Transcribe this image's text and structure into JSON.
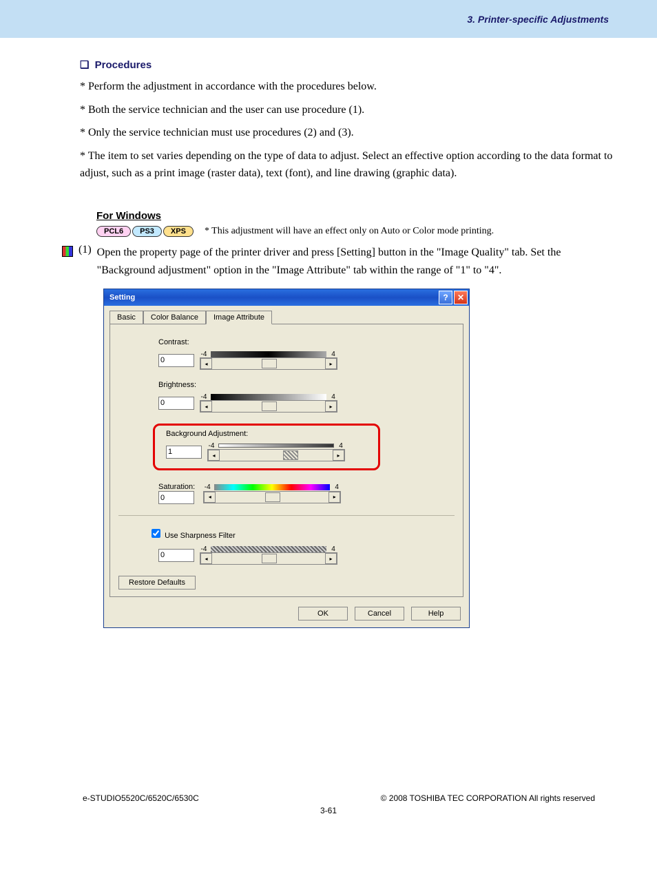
{
  "header": {
    "chapter": "3. Printer-specific Adjustments"
  },
  "procedures": {
    "heading": "Procedures",
    "lines": [
      "* Perform the adjustment in accordance with the procedures below.",
      "* Both the service technician and the user can use procedure (1).",
      "* Only the service technician must use procedures (2) and (3).",
      "* The item to set varies depending on the type of data to adjust.  Select an effective option according to the data format to adjust, such as a print image (raster data), text (font), and line drawing (graphic data)."
    ]
  },
  "for_windows": {
    "label": "For Windows",
    "pills": {
      "pcl6": "PCL6",
      "ps3": "PS3",
      "xps": "XPS"
    },
    "note": "* This adjustment will have an effect only on Auto or Color mode printing."
  },
  "step1": {
    "num": "(1)",
    "text": "Open the property page of the printer driver and press [Setting] button in the \"Image Quality\" tab. Set the \"Background adjustment\" option in the \"Image Attribute\" tab within the range of \"1\" to \"4\"."
  },
  "dialog": {
    "title": "Setting",
    "help_glyph": "?",
    "close_glyph": "✕",
    "tabs": {
      "basic": "Basic",
      "color_balance": "Color Balance",
      "image_attribute": "Image Attribute"
    },
    "contrast": {
      "label": "Contrast:",
      "value": "0",
      "min": "-4",
      "max": "4"
    },
    "brightness": {
      "label": "Brightness:",
      "value": "0",
      "min": "-4",
      "max": "4"
    },
    "background": {
      "label": "Background Adjustment:",
      "value": "1",
      "min": "-4",
      "max": "4"
    },
    "saturation": {
      "label": "Saturation:",
      "value": "0",
      "min": "-4",
      "max": "4"
    },
    "sharpness": {
      "check_label": "Use Sharpness Filter",
      "value": "0",
      "min": "-4",
      "max": "4"
    },
    "restore": "Restore Defaults",
    "buttons": {
      "ok": "OK",
      "cancel": "Cancel",
      "help": "Help"
    }
  },
  "footer": {
    "left": "e-STUDIO5520C/6520C/6530C",
    "right": "© 2008 TOSHIBA TEC CORPORATION All rights reserved",
    "page": "3-61"
  }
}
